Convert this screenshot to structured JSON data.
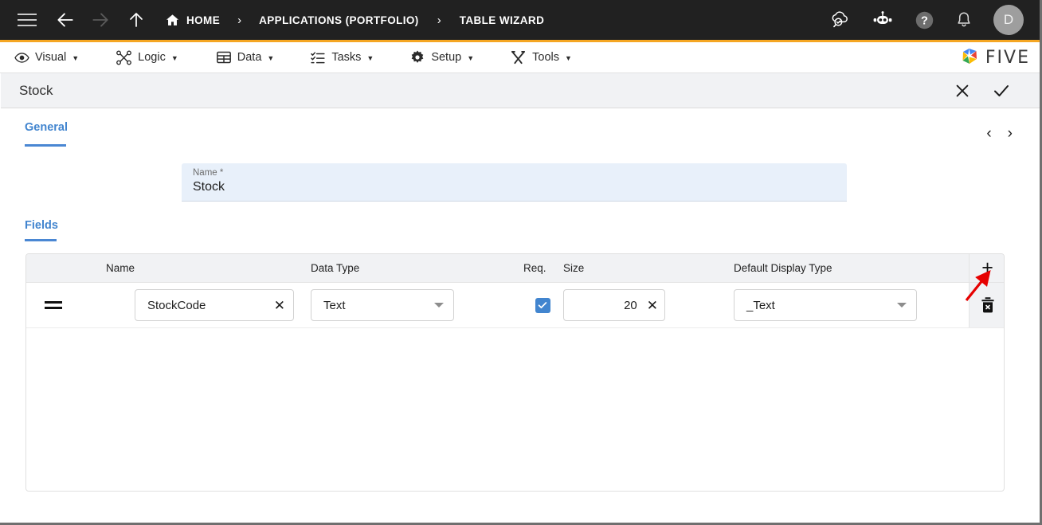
{
  "topbar": {
    "menu_icon": "hamburger-icon",
    "back_icon": "arrow-left-icon",
    "forward_icon": "arrow-right-icon",
    "up_icon": "arrow-up-icon",
    "home_icon": "home-icon",
    "breadcrumb": [
      {
        "label": "HOME"
      },
      {
        "label": "APPLICATIONS (PORTFOLIO)"
      },
      {
        "label": "TABLE WIZARD"
      }
    ],
    "separator": "›",
    "actions": [
      {
        "name": "cloud-check-search-icon"
      },
      {
        "name": "robot-assistant-icon"
      },
      {
        "name": "help-icon",
        "glyph": "?"
      },
      {
        "name": "notifications-bell-icon"
      }
    ],
    "avatar_initial": "D",
    "bg": "#212121",
    "accent": "#f5a623"
  },
  "menubar": {
    "items": [
      {
        "label": "Visual",
        "icon": "eye-icon",
        "caret": "▼"
      },
      {
        "label": "Logic",
        "icon": "logic-nodes-icon",
        "caret": "▼"
      },
      {
        "label": "Data",
        "icon": "table-grid-icon",
        "caret": "▼"
      },
      {
        "label": "Tasks",
        "icon": "checklist-icon",
        "caret": "▼"
      },
      {
        "label": "Setup",
        "icon": "gear-icon",
        "caret": "▼"
      },
      {
        "label": "Tools",
        "icon": "tools-cross-icon",
        "caret": "▼"
      }
    ],
    "brand": {
      "word": "FIVE",
      "logo_icon": "five-pinwheel-logo-icon",
      "logo_colors": [
        "#4285f4",
        "#ea4335",
        "#fbbc05",
        "#34a853"
      ]
    }
  },
  "form_header": {
    "title": "Stock",
    "close_label": "✕",
    "confirm_label": "✓"
  },
  "general": {
    "tab_label": "General",
    "prev_label": "‹",
    "next_label": "›",
    "name_field": {
      "label": "Name *",
      "value": "Stock"
    }
  },
  "fields_section": {
    "tab_label": "Fields",
    "columns": [
      {
        "key": "handle",
        "label": ""
      },
      {
        "key": "name",
        "label": "Name"
      },
      {
        "key": "data_type",
        "label": "Data Type"
      },
      {
        "key": "req",
        "label": "Req."
      },
      {
        "key": "size",
        "label": "Size"
      },
      {
        "key": "display_type",
        "label": "Default Display Type"
      }
    ],
    "add_button_label": "+",
    "rows": [
      {
        "handle_icon": "drag-handle-icon",
        "name": "StockCode",
        "name_clear": "✕",
        "data_type": "Text",
        "required": true,
        "size": "20",
        "size_clear": "✕",
        "display_type": "_Text",
        "delete_icon": "trash-icon"
      }
    ]
  },
  "annotation": {
    "arrow_color": "#e60000",
    "points_to": "add-field-button"
  }
}
